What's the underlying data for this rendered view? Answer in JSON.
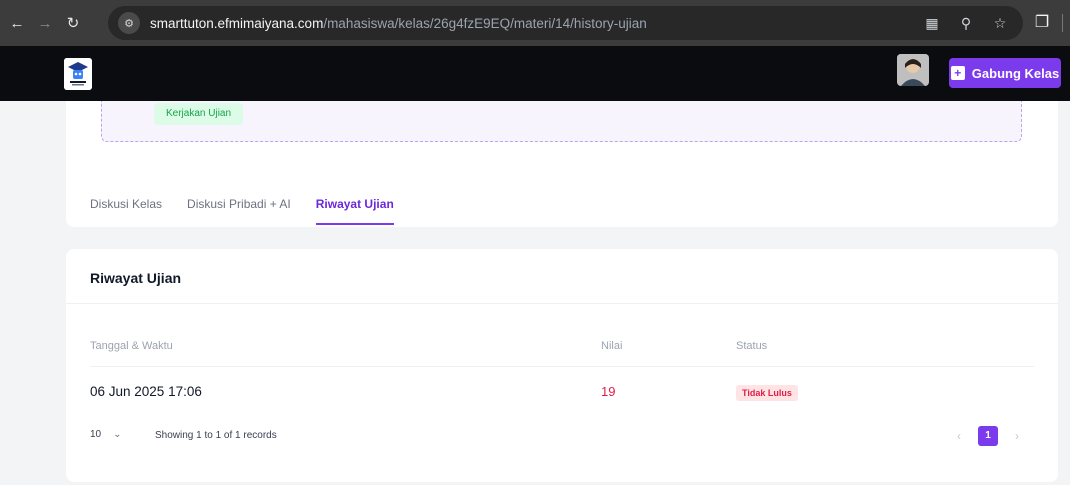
{
  "browser": {
    "url_host": "smarttuton.efmimaiyana.com",
    "url_path": "/mahasiswa/kelas/26g4fzE9EQ/materi/14/history-ujian"
  },
  "header": {
    "join_label": "Gabung Kelas"
  },
  "top_card": {
    "exam_button": "Kerjakan Ujian",
    "tabs": [
      {
        "label": "Diskusi Kelas",
        "active": false
      },
      {
        "label": "Diskusi Pribadi + AI",
        "active": false
      },
      {
        "label": "Riwayat Ujian",
        "active": true
      }
    ]
  },
  "history": {
    "title": "Riwayat Ujian",
    "columns": [
      "Tanggal & Waktu",
      "Nilai",
      "Status"
    ],
    "rows": [
      {
        "date": "06 Jun 2025 17:06",
        "score": "19",
        "status": "Tidak Lulus"
      }
    ],
    "per_page": "10",
    "records_text": "Showing 1 to 1 of 1 records",
    "current_page": "1"
  },
  "colors": {
    "accent": "#7c3aed",
    "fail": "#e11d48",
    "success": "#16a34a"
  }
}
